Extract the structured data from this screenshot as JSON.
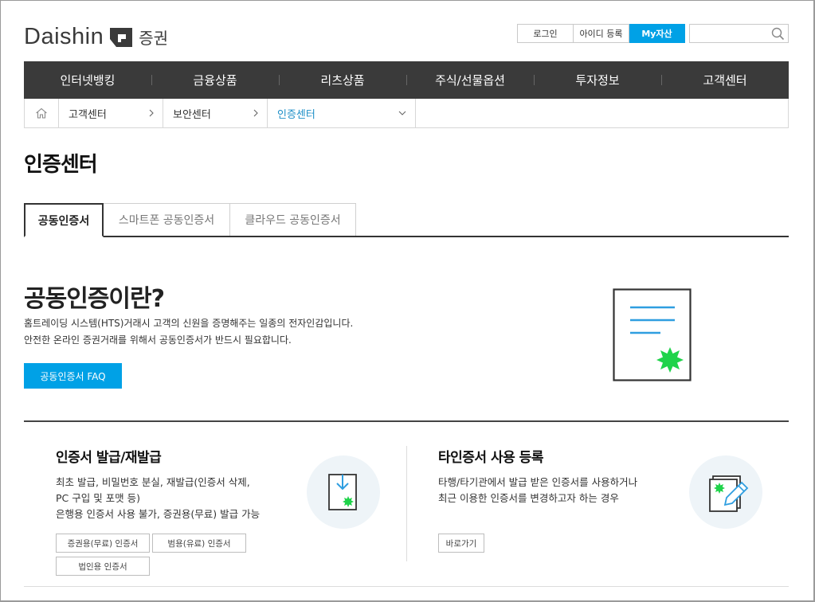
{
  "header": {
    "logo_text": "Daishin",
    "logo_sub": "증권",
    "login_label": "로그인",
    "register_label": "아이디 등록",
    "my_assets_label": "My자산",
    "search_placeholder": ""
  },
  "gnb": [
    {
      "label": "인터넷뱅킹"
    },
    {
      "label": "금융상품"
    },
    {
      "label": "리츠상품"
    },
    {
      "label": "주식/선물옵션"
    },
    {
      "label": "투자정보"
    },
    {
      "label": "고객센터"
    }
  ],
  "breadcrumb": {
    "items": [
      {
        "label": "고객센터"
      },
      {
        "label": "보안센터"
      },
      {
        "label": "인증센터"
      }
    ]
  },
  "page_title": "인증센터",
  "tabs": [
    {
      "label": "공동인증서",
      "active": true
    },
    {
      "label": "스마트폰 공동인증서",
      "active": false
    },
    {
      "label": "클라우드 공동인증서",
      "active": false
    }
  ],
  "intro": {
    "title": "공동인증이란?",
    "line1": "홈트레이딩 시스템(HTS)거래시 고객의 신원을 증명해주는 일종의 전자인감입니다.",
    "line2": "안전한 온라인 증권거래를 위해서 공동인증서가 반드시 필요합니다.",
    "faq_button": "공동인증서 FAQ"
  },
  "cards": {
    "issue": {
      "title": "인증서 발급/재발급",
      "line1": "최초 발급, 비밀번호 분실, 재발급(인증서 삭제,",
      "line2": "PC 구입 및 포맷 등)",
      "line3": "은행용 인증서 사용 불가, 증권용(무료) 발급 가능",
      "btn_securities": "증권용(무료) 인증서",
      "btn_general": "범용(유료) 인증서",
      "btn_corporate": "법인용 인증서"
    },
    "register": {
      "title": "타인증서 사용 등록",
      "line1": "타행/타기관에서 발급 받은 인증서를 사용하거나",
      "line2": "최근 이용한 인증서를 변경하고자 하는 경우",
      "btn_go": "바로가기"
    }
  },
  "colors": {
    "accent": "#00a1e6",
    "gnb_bg": "#3a3a3a",
    "badge_green": "#1fd34a",
    "breadcrumb_active": "#1e8fc7"
  }
}
